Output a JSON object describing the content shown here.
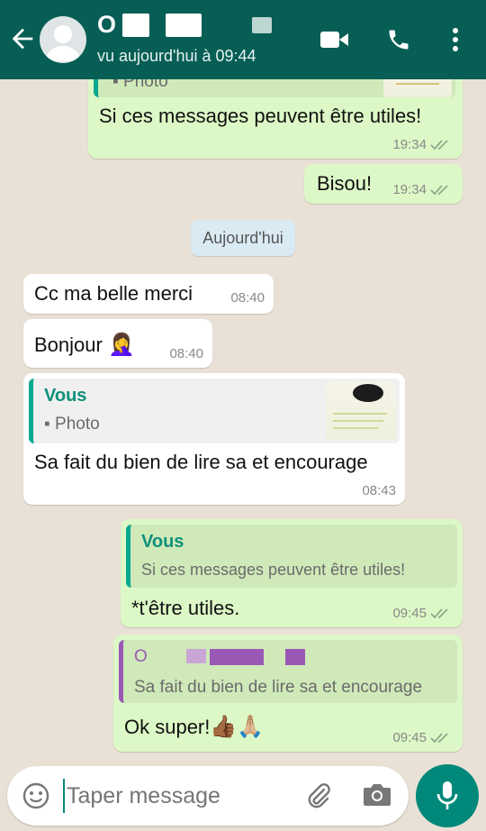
{
  "header": {
    "contact_initial": "O",
    "last_seen": "vu aujourd'hui à 09:44",
    "icons": [
      "back-arrow-icon",
      "video-call-icon",
      "phone-icon",
      "more-vert-icon"
    ]
  },
  "messages": {
    "m1": {
      "quote_label": "Photo",
      "text": "Si ces messages peuvent être utiles!",
      "time": "19:34"
    },
    "m2": {
      "text": "Bisou!",
      "time": "19:34"
    },
    "date_separator": "Aujourd'hui",
    "m3": {
      "text": "Cc ma belle merci",
      "time": "08:40"
    },
    "m4": {
      "text": "Bonjour",
      "emoji": "🤦‍♀️",
      "time": "08:40"
    },
    "m5": {
      "quote_author": "Vous",
      "quote_label": "Photo",
      "text": "Sa fait du bien de lire sa et encourage",
      "time": "08:43"
    },
    "m6": {
      "quote_author": "Vous",
      "quote_text": "Si ces messages peuvent être utiles!",
      "text": "*t'être utiles.",
      "time": "09:45"
    },
    "m7": {
      "quote_author": "O",
      "quote_text": "Sa fait du bien de lire sa et encourage",
      "text": "Ok super!",
      "emoji": "👍🏾🙏🏼",
      "time": "09:45"
    }
  },
  "composer": {
    "placeholder": "Taper message"
  },
  "colors": {
    "header": "#075e54",
    "outgoing_bubble": "#dcf8c6",
    "incoming_bubble": "#ffffff",
    "quote_accent": "#06a88e",
    "read_ticks": "#8fa88a",
    "mic_button": "#00897b"
  }
}
